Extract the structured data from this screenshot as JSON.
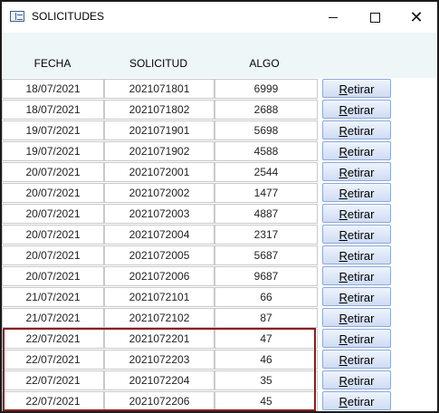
{
  "window": {
    "title": "SOLICITUDES",
    "controls": {
      "minimize": "minimize",
      "maximize": "maximize",
      "close": "✕"
    }
  },
  "columns": {
    "fecha": "FECHA",
    "solicitud": "SOLICITUD",
    "algo": "ALGO"
  },
  "action_label_first": "R",
  "action_label_rest": "etirar",
  "rows": [
    {
      "fecha": "18/07/2021",
      "solicitud": "2021071801",
      "algo": "6999"
    },
    {
      "fecha": "18/07/2021",
      "solicitud": "2021071802",
      "algo": "2688"
    },
    {
      "fecha": "19/07/2021",
      "solicitud": "2021071901",
      "algo": "5698"
    },
    {
      "fecha": "19/07/2021",
      "solicitud": "2021071902",
      "algo": "4588"
    },
    {
      "fecha": "20/07/2021",
      "solicitud": "2021072001",
      "algo": "2544"
    },
    {
      "fecha": "20/07/2021",
      "solicitud": "2021072002",
      "algo": "1477"
    },
    {
      "fecha": "20/07/2021",
      "solicitud": "2021072003",
      "algo": "4887"
    },
    {
      "fecha": "20/07/2021",
      "solicitud": "2021072004",
      "algo": "2317"
    },
    {
      "fecha": "20/07/2021",
      "solicitud": "2021072005",
      "algo": "5687"
    },
    {
      "fecha": "20/07/2021",
      "solicitud": "2021072006",
      "algo": "9687"
    },
    {
      "fecha": "21/07/2021",
      "solicitud": "2021072101",
      "algo": "66"
    },
    {
      "fecha": "21/07/2021",
      "solicitud": "2021072102",
      "algo": "87"
    },
    {
      "fecha": "22/07/2021",
      "solicitud": "2021072201",
      "algo": "47"
    },
    {
      "fecha": "22/07/2021",
      "solicitud": "2021072203",
      "algo": "46"
    },
    {
      "fecha": "22/07/2021",
      "solicitud": "2021072204",
      "algo": "35"
    },
    {
      "fecha": "22/07/2021",
      "solicitud": "2021072206",
      "algo": "45"
    }
  ],
  "colors": {
    "header_band": "#eef6f8",
    "button_border": "#8ea9d8",
    "highlight_border": "#8b1c1c"
  }
}
